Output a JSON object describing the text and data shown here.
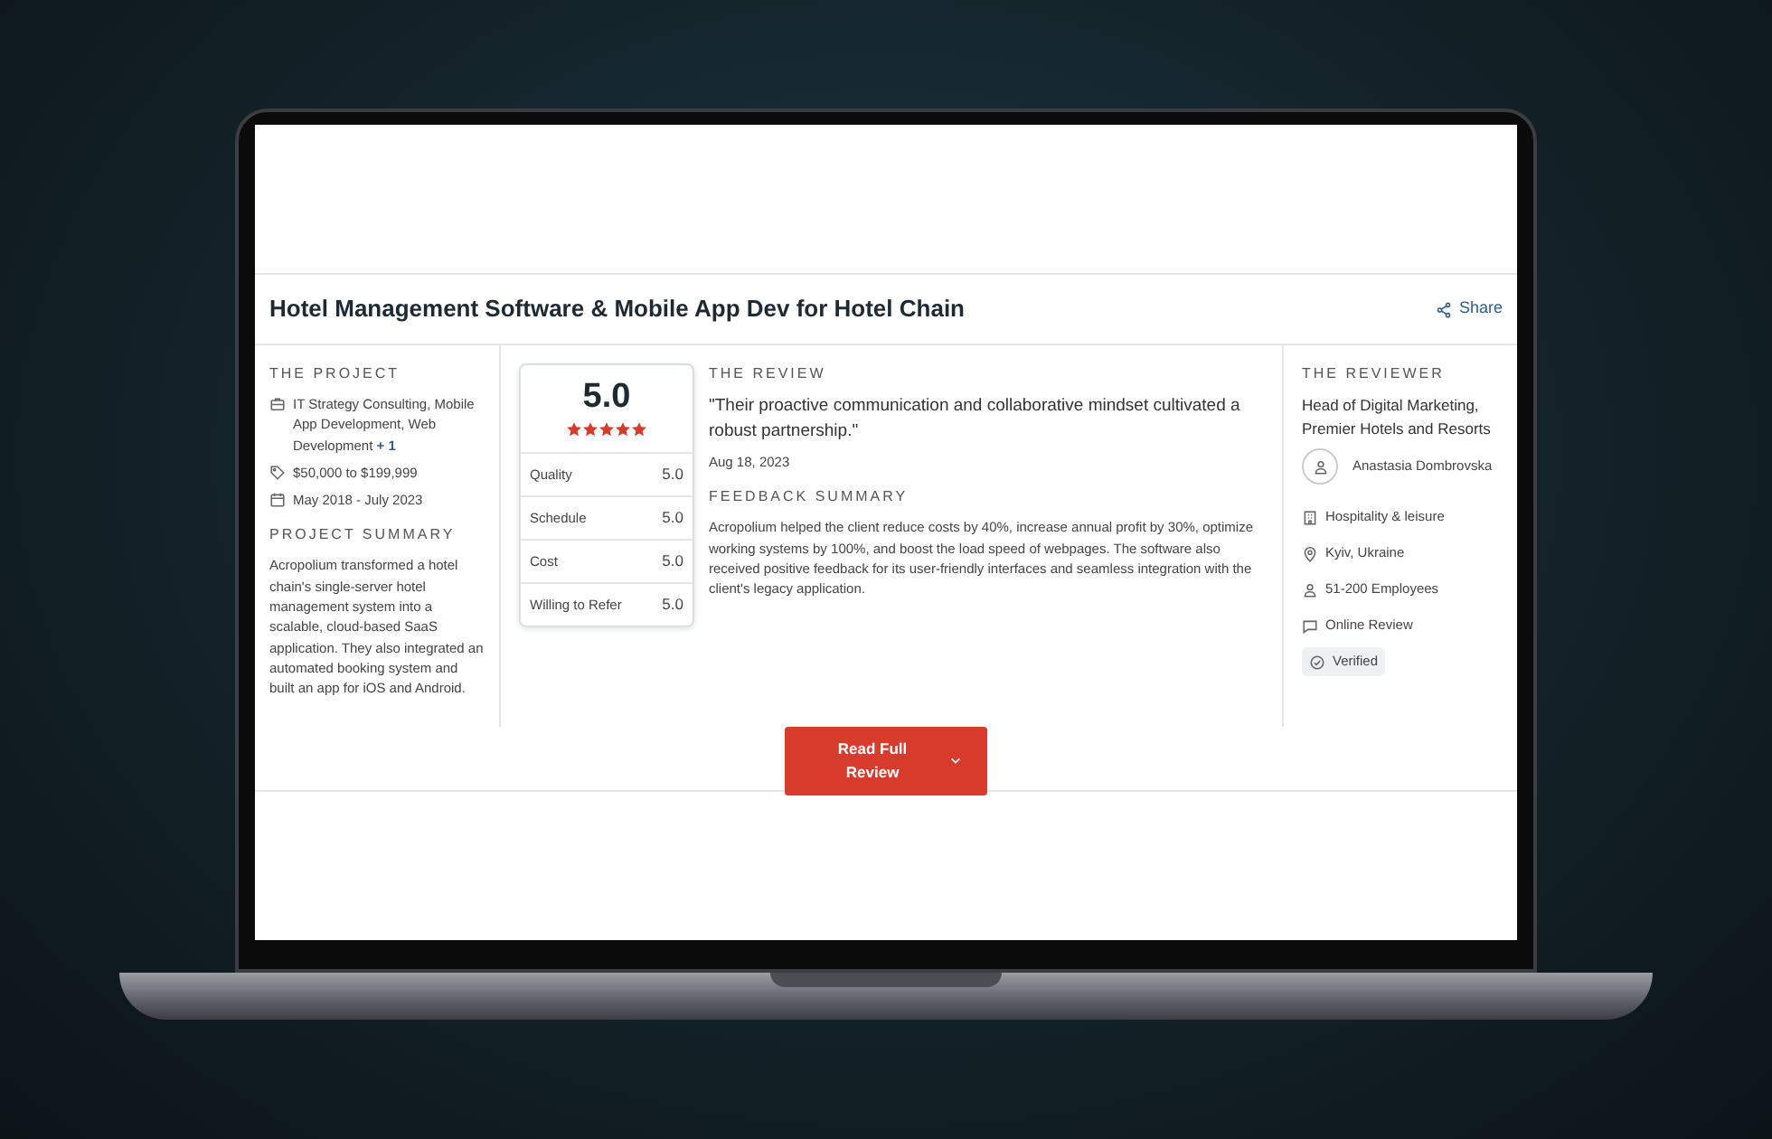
{
  "header": {
    "title": "Hotel Management Software & Mobile App Dev for Hotel Chain",
    "share": "Share"
  },
  "project": {
    "heading": "THE PROJECT",
    "services": "IT Strategy Consulting, Mobile App Development, Web Development",
    "services_more": "+ 1",
    "budget": "$50,000 to $199,999",
    "dates": "May 2018 - July 2023",
    "summary_heading": "PROJECT SUMMARY",
    "summary": "Acropolium transformed a hotel chain's single-server hotel management system into a scalable, cloud-based SaaS application. They also integrated an automated booking system and built an app for iOS and Android."
  },
  "rating": {
    "score": "5.0",
    "stars": 5,
    "rows": [
      {
        "label": "Quality",
        "value": "5.0"
      },
      {
        "label": "Schedule",
        "value": "5.0"
      },
      {
        "label": "Cost",
        "value": "5.0"
      },
      {
        "label": "Willing to Refer",
        "value": "5.0"
      }
    ]
  },
  "review": {
    "heading": "THE REVIEW",
    "quote": "\"Their proactive communication and collaborative mindset cultivated a robust partnership.\"",
    "date": "Aug 18, 2023",
    "feedback_heading": "FEEDBACK SUMMARY",
    "feedback": "Acropolium helped the client reduce costs by 40%, increase annual profit by 30%, optimize working systems by 100%, and boost the load speed of webpages. The software also received positive feedback for its user-friendly interfaces and seamless integration with the client's legacy application."
  },
  "reviewer": {
    "heading": "THE REVIEWER",
    "role": "Head of Digital Marketing, Premier Hotels and Resorts",
    "name": "Anastasia Dombrovska",
    "facts": [
      {
        "kind": "industry",
        "text": "Hospitality & leisure"
      },
      {
        "kind": "location",
        "text": "Kyiv, Ukraine"
      },
      {
        "kind": "size",
        "text": "51-200 Employees"
      },
      {
        "kind": "source",
        "text": "Online Review"
      },
      {
        "kind": "verified",
        "text": "Verified"
      }
    ]
  },
  "button": {
    "label": "Read Full Review"
  }
}
